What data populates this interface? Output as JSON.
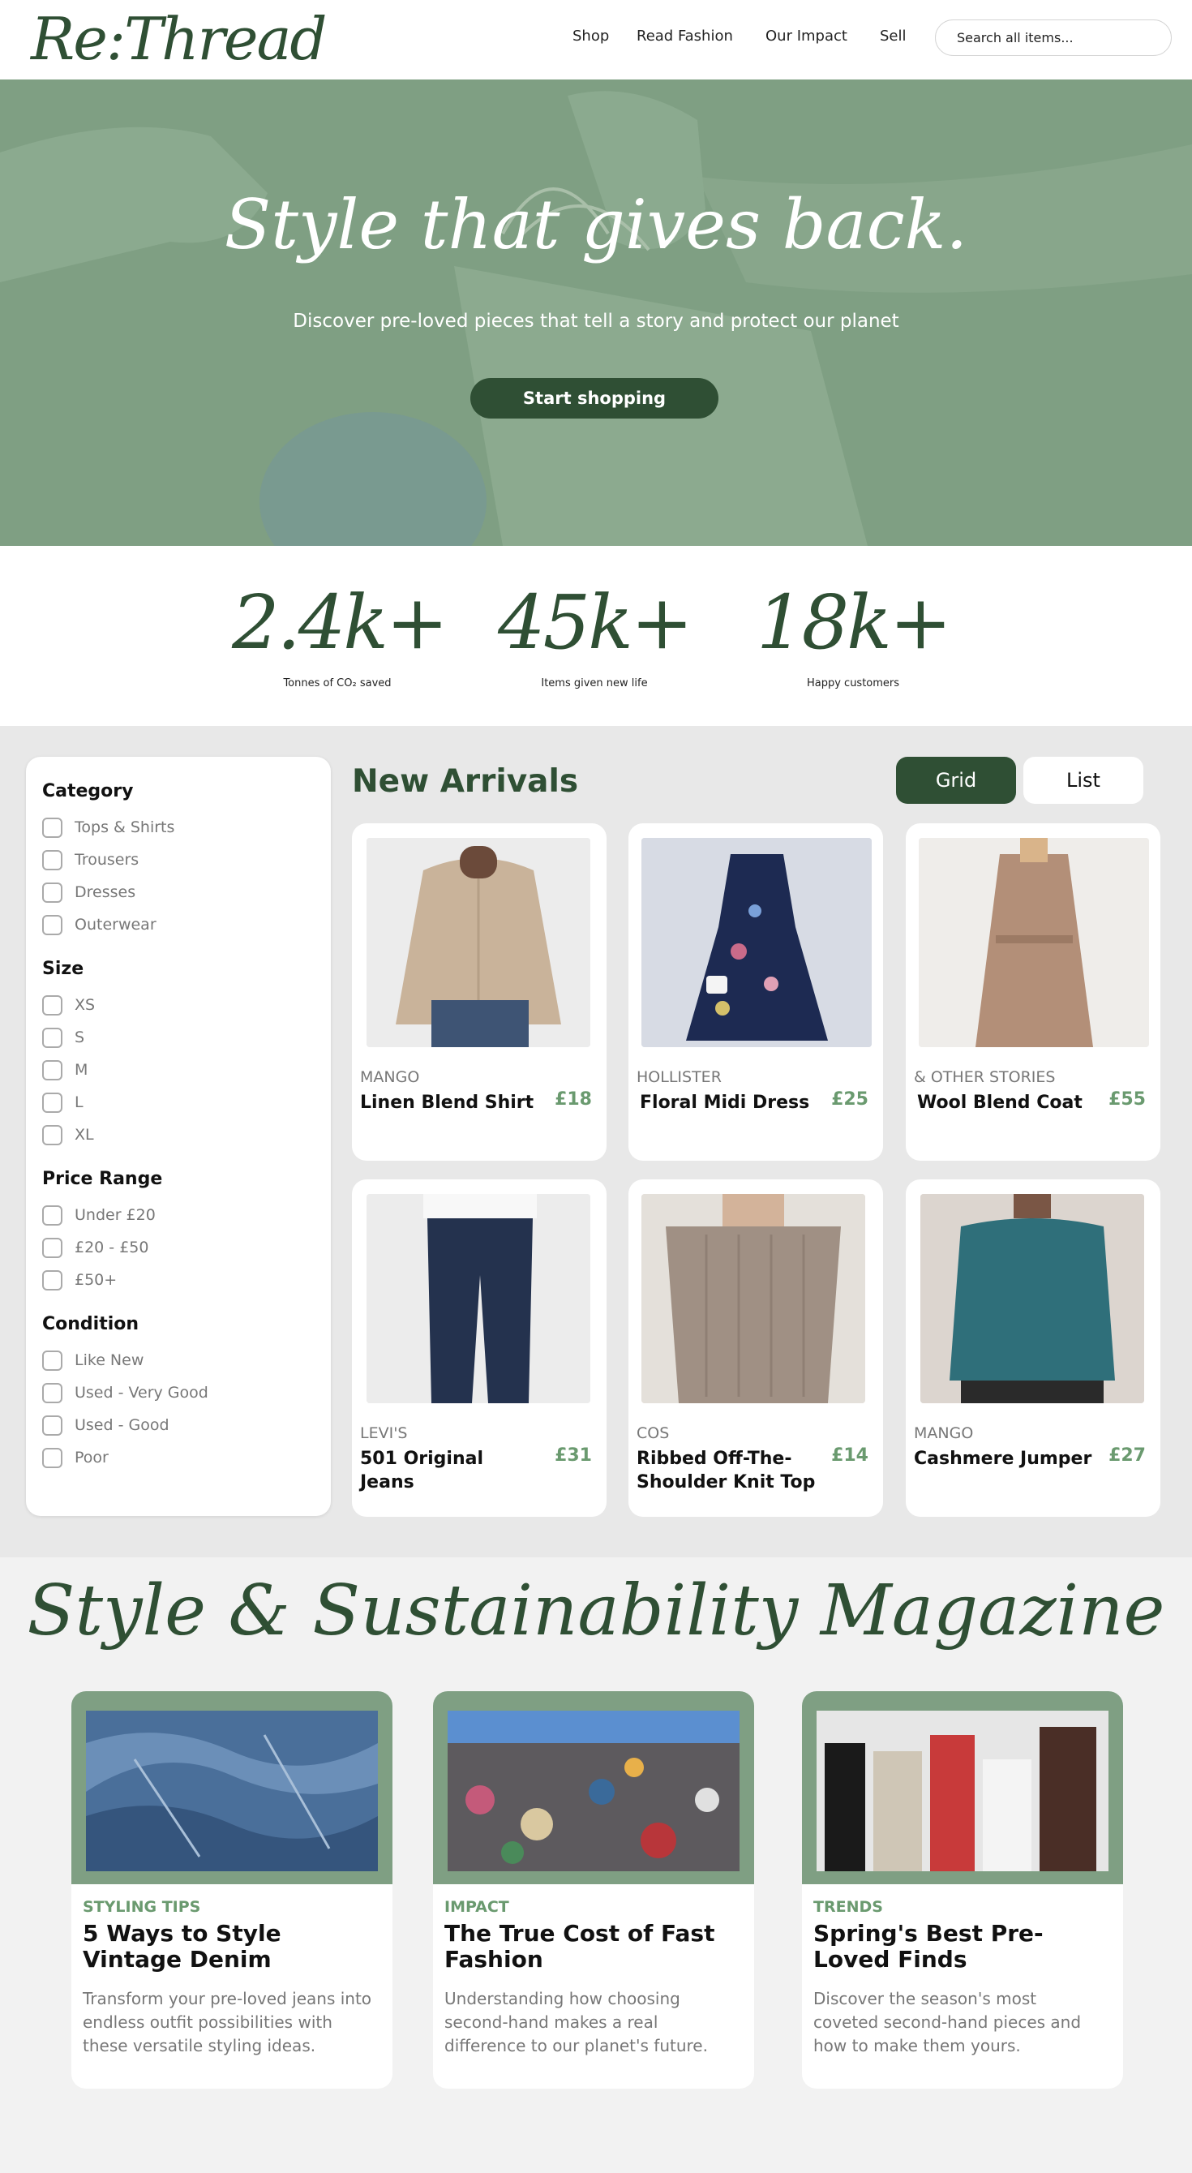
{
  "header": {
    "logo": "Re:Thread",
    "nav": [
      "Shop",
      "Read Fashion",
      "Our Impact",
      "Sell"
    ],
    "search_placeholder": "Search all items..."
  },
  "hero": {
    "title": "Style that gives back.",
    "subtitle": "Discover pre-loved pieces that tell a story and protect our planet",
    "cta": "Start shopping"
  },
  "stats": [
    {
      "value": "2.4k+",
      "label": "Tonnes of CO₂ saved"
    },
    {
      "value": "45k+",
      "label": "Items given new life"
    },
    {
      "value": "18k+",
      "label": "Happy customers"
    }
  ],
  "filters": {
    "groups": [
      {
        "heading": "Category",
        "options": [
          "Tops & Shirts",
          "Trousers",
          "Dresses",
          "Outerwear"
        ]
      },
      {
        "heading": "Size",
        "options": [
          "XS",
          "S",
          "M",
          "L",
          "XL"
        ]
      },
      {
        "heading": "Price Range",
        "options": [
          "Under £20",
          "£20 - £50",
          "£50+"
        ]
      },
      {
        "heading": "Condition",
        "options": [
          "Like New",
          "Used - Very Good",
          "Used - Good",
          "Poor"
        ]
      }
    ]
  },
  "arrivals": {
    "title": "New Arrivals",
    "view_grid": "Grid",
    "view_list": "List",
    "active_view": "Grid",
    "products": [
      {
        "brand": "MANGO",
        "name": "Linen Blend Shirt",
        "price": "£18",
        "image": "beige-linen-shirt"
      },
      {
        "brand": "HOLLISTER",
        "name": "Floral Midi Dress",
        "price": "£25",
        "image": "navy-floral-dress"
      },
      {
        "brand": "& OTHER STORIES",
        "name": "Wool Blend Coat",
        "price": "£55",
        "image": "camel-wool-coat"
      },
      {
        "brand": "LEVI'S",
        "name": "501 Original Jeans",
        "price": "£31",
        "image": "dark-denim-jeans"
      },
      {
        "brand": "COS",
        "name": "Ribbed Off-The-Shoulder Knit Top",
        "price": "£14",
        "image": "taupe-knit-top"
      },
      {
        "brand": "MANGO",
        "name": "Cashmere Jumper",
        "price": "£27",
        "image": "teal-cashmere-jumper"
      }
    ]
  },
  "magazine": {
    "title": "Style & Sustainability Magazine",
    "articles": [
      {
        "category": "STYLING TIPS",
        "title": "5 Ways to Style Vintage Denim",
        "desc": "Transform your pre-loved jeans into endless outfit possibilities with these versatile styling ideas.",
        "image": "denim-pile"
      },
      {
        "category": "IMPACT",
        "title": "The True Cost of Fast Fashion",
        "desc": "Understanding how choosing second-hand makes a real difference to our planet's future.",
        "image": "clothing-landfill"
      },
      {
        "category": "TRENDS",
        "title": "Spring's Best Pre-Loved Finds",
        "desc": "Discover the season's most coveted second-hand pieces and how to make them yours.",
        "image": "group-street-style"
      }
    ]
  },
  "colors": {
    "brand_green": "#2f4f34",
    "sage": "#7f9f83",
    "price_green": "#6a9a6f"
  }
}
